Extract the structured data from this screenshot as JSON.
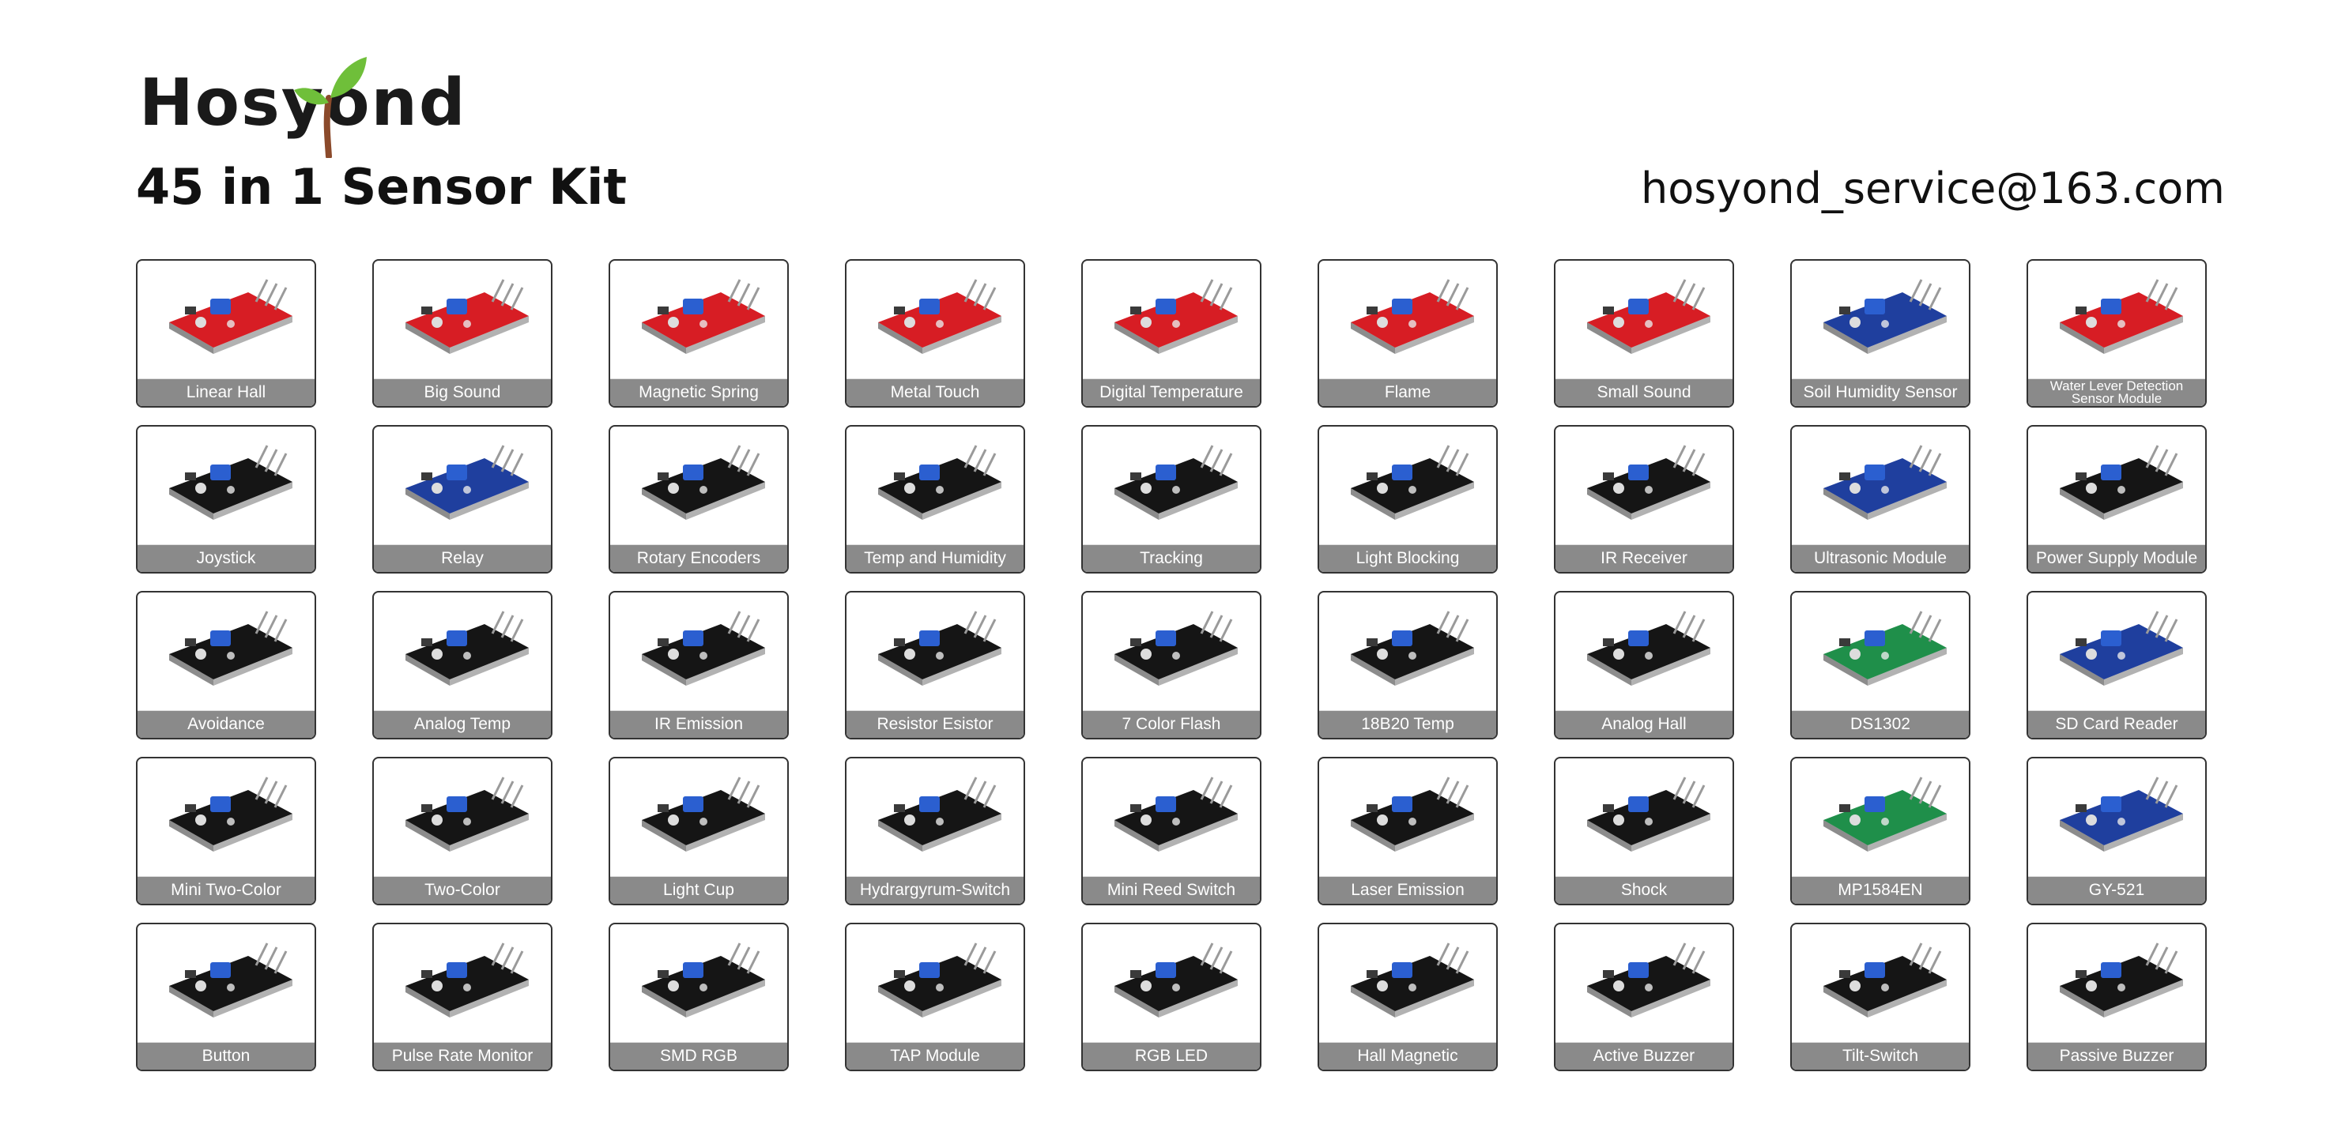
{
  "brand": {
    "name": "Hosyond"
  },
  "title": "45 in 1 Sensor Kit",
  "email": "hosyond_service@163.com",
  "colors": {
    "label_bar": "#8a8a8a",
    "board_red": "#d71d24",
    "board_black": "#151515",
    "board_blue": "#1f3f9e",
    "board_green": "#1f8f4a",
    "sprout_green": "#6fbf3a",
    "sprout_stem": "#8b4a2b"
  },
  "sensors": [
    {
      "label": "Linear Hall",
      "board": "red",
      "icon": "linear-hall-module-icon"
    },
    {
      "label": "Big Sound",
      "board": "red",
      "icon": "big-sound-module-icon"
    },
    {
      "label": "Magnetic Spring",
      "board": "red",
      "icon": "magnetic-spring-module-icon"
    },
    {
      "label": "Metal Touch",
      "board": "red",
      "icon": "metal-touch-module-icon"
    },
    {
      "label": "Digital Temperature",
      "board": "red",
      "icon": "digital-temperature-module-icon"
    },
    {
      "label": "Flame",
      "board": "red",
      "icon": "flame-module-icon"
    },
    {
      "label": "Small Sound",
      "board": "red",
      "icon": "small-sound-module-icon"
    },
    {
      "label": "Soil Humidity Sensor",
      "board": "blue",
      "icon": "soil-humidity-module-icon"
    },
    {
      "label": "Water Lever Detection Sensor Module",
      "board": "red",
      "icon": "water-level-module-icon"
    },
    {
      "label": "Joystick",
      "board": "black",
      "icon": "joystick-module-icon"
    },
    {
      "label": "Relay",
      "board": "blue",
      "icon": "relay-module-icon"
    },
    {
      "label": "Rotary Encoders",
      "board": "black",
      "icon": "rotary-encoder-module-icon"
    },
    {
      "label": "Temp and Humidity",
      "board": "black",
      "icon": "temp-humidity-module-icon"
    },
    {
      "label": "Tracking",
      "board": "black",
      "icon": "tracking-module-icon"
    },
    {
      "label": "Light Blocking",
      "board": "black",
      "icon": "light-blocking-module-icon"
    },
    {
      "label": "IR Receiver",
      "board": "black",
      "icon": "ir-receiver-module-icon"
    },
    {
      "label": "Ultrasonic Module",
      "board": "blue",
      "icon": "ultrasonic-module-icon"
    },
    {
      "label": "Power Supply Module",
      "board": "black",
      "icon": "power-supply-module-icon"
    },
    {
      "label": "Avoidance",
      "board": "black",
      "icon": "avoidance-module-icon"
    },
    {
      "label": "Analog Temp",
      "board": "black",
      "icon": "analog-temp-module-icon"
    },
    {
      "label": "IR Emission",
      "board": "black",
      "icon": "ir-emission-module-icon"
    },
    {
      "label": "Resistor Esistor",
      "board": "black",
      "icon": "photoresistor-module-icon"
    },
    {
      "label": "7 Color Flash",
      "board": "black",
      "icon": "seven-color-flash-module-icon"
    },
    {
      "label": "18B20 Temp",
      "board": "black",
      "icon": "ds18b20-temp-module-icon"
    },
    {
      "label": "Analog Hall",
      "board": "black",
      "icon": "analog-hall-module-icon"
    },
    {
      "label": "DS1302",
      "board": "green",
      "icon": "ds1302-clock-module-icon"
    },
    {
      "label": "SD Card Reader",
      "board": "blue",
      "icon": "sd-card-reader-module-icon"
    },
    {
      "label": "Mini Two-Color",
      "board": "black",
      "icon": "mini-two-color-led-module-icon"
    },
    {
      "label": "Two-Color",
      "board": "black",
      "icon": "two-color-led-module-icon"
    },
    {
      "label": "Light Cup",
      "board": "black",
      "icon": "light-cup-module-icon"
    },
    {
      "label": "Hydrargyrum-Switch",
      "board": "black",
      "icon": "mercury-switch-module-icon"
    },
    {
      "label": "Mini Reed Switch",
      "board": "black",
      "icon": "mini-reed-switch-module-icon"
    },
    {
      "label": "Laser Emission",
      "board": "black",
      "icon": "laser-emission-module-icon"
    },
    {
      "label": "Shock",
      "board": "black",
      "icon": "shock-module-icon"
    },
    {
      "label": "MP1584EN",
      "board": "green",
      "icon": "mp1584en-module-icon"
    },
    {
      "label": "GY-521",
      "board": "blue",
      "icon": "gy521-module-icon"
    },
    {
      "label": "Button",
      "board": "black",
      "icon": "button-module-icon"
    },
    {
      "label": "Pulse Rate Monitor",
      "board": "black",
      "icon": "pulse-rate-module-icon"
    },
    {
      "label": "SMD RGB",
      "board": "black",
      "icon": "smd-rgb-module-icon"
    },
    {
      "label": "TAP Module",
      "board": "black",
      "icon": "tap-module-icon"
    },
    {
      "label": "RGB LED",
      "board": "black",
      "icon": "rgb-led-module-icon"
    },
    {
      "label": "Hall Magnetic",
      "board": "black",
      "icon": "hall-magnetic-module-icon"
    },
    {
      "label": "Active Buzzer",
      "board": "black",
      "icon": "active-buzzer-module-icon"
    },
    {
      "label": "Tilt-Switch",
      "board": "black",
      "icon": "tilt-switch-module-icon"
    },
    {
      "label": "Passive Buzzer",
      "board": "black",
      "icon": "passive-buzzer-module-icon"
    }
  ]
}
